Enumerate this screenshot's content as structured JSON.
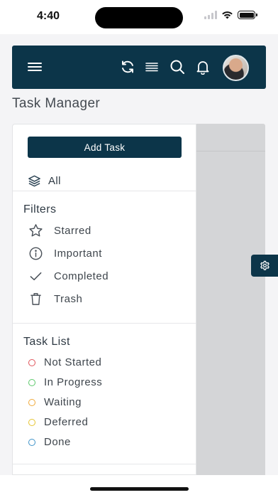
{
  "status_bar": {
    "time": "4:40"
  },
  "topbar": {
    "menu_icon": "hamburger-menu-icon",
    "refresh_icon": "refresh-icon",
    "list_icon": "list-lines-icon",
    "search_icon": "search-icon",
    "bell_icon": "bell-icon",
    "avatar": "user-avatar"
  },
  "page": {
    "title": "Task Manager"
  },
  "sidebar": {
    "add_task_label": "Add Task",
    "all_label": "All",
    "filters": {
      "title": "Filters",
      "items": [
        {
          "label": "Starred",
          "icon": "star-icon"
        },
        {
          "label": "Important",
          "icon": "info-icon"
        },
        {
          "label": "Completed",
          "icon": "check-icon"
        },
        {
          "label": "Trash",
          "icon": "trash-icon"
        }
      ]
    },
    "task_list": {
      "title": "Task List",
      "items": [
        {
          "label": "Not Started",
          "color": "#e0555b"
        },
        {
          "label": "In Progress",
          "color": "#5cc96b"
        },
        {
          "label": "Waiting",
          "color": "#f0a93a"
        },
        {
          "label": "Deferred",
          "color": "#e6c431"
        },
        {
          "label": "Done",
          "color": "#3f93c8"
        }
      ]
    }
  },
  "colors": {
    "primary": "#0c3549",
    "panel_gray": "#d4d5d7",
    "background": "#f4f4f6"
  }
}
